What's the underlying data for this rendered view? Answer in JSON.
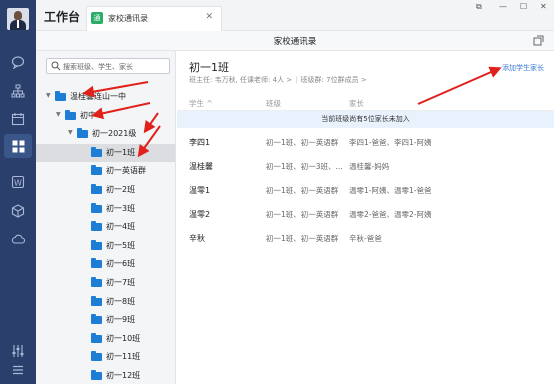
{
  "app": {
    "title": "工作台",
    "tab_label": "家校通讯录",
    "tab_icon_glyph": "通",
    "window_title": "家校通讯录"
  },
  "window_controls": [
    "⧉",
    "—",
    "☐",
    "✕"
  ],
  "sidebar": {
    "search_placeholder": "搜索班级、学生、家长",
    "tree": [
      {
        "label": "温桂馨连山一中",
        "expanded": true,
        "level": 0
      },
      {
        "label": "初中",
        "expanded": true,
        "level": 1
      },
      {
        "label": "初一2021级",
        "expanded": true,
        "level": 2
      },
      {
        "label": "初一1班",
        "level": 3,
        "selected": true
      },
      {
        "label": "初一英语群",
        "level": 3
      },
      {
        "label": "初一2班",
        "level": 3
      },
      {
        "label": "初一3班",
        "level": 3
      },
      {
        "label": "初一4班",
        "level": 3
      },
      {
        "label": "初一5班",
        "level": 3
      },
      {
        "label": "初一6班",
        "level": 3
      },
      {
        "label": "初一7班",
        "level": 3
      },
      {
        "label": "初一8班",
        "level": 3
      },
      {
        "label": "初一9班",
        "level": 3
      },
      {
        "label": "初一10班",
        "level": 3
      },
      {
        "label": "初一11班",
        "level": 3
      },
      {
        "label": "初一12班",
        "level": 3
      }
    ]
  },
  "main": {
    "class_title": "初一1班",
    "meta_teacher": "班主任: 韦万秋, 任课老师: 4人 >",
    "meta_group": "班级群: 7位群成员 >",
    "add_link": "添加学生家长",
    "columns": [
      "学生 ^",
      "班级",
      "家长"
    ],
    "notice": "当前班级尚有5位家长未加入",
    "rows": [
      {
        "student": "李四1",
        "classes": "初一1班、初一英语群",
        "parents": "李四1-爸爸、李四1-阿姨"
      },
      {
        "student": "温桂馨",
        "classes": "初一1班、初一3班、...",
        "parents": "温桂馨-妈妈"
      },
      {
        "student": "温零1",
        "classes": "初一1班、初一英语群",
        "parents": "温零1-阿姨、温零1-爸爸"
      },
      {
        "student": "温零2",
        "classes": "初一1班、初一英语群",
        "parents": "温零2-爸爸、温零2-阿姨"
      },
      {
        "student": "辛秋",
        "classes": "初一1班、初一英语群",
        "parents": "辛秋-爸爸"
      }
    ]
  },
  "colors": {
    "rail": "#2a3f6c",
    "accent_link": "#3a7bd5",
    "folder": "#1e7ed6",
    "annotation_arrow": "#e0201a"
  }
}
